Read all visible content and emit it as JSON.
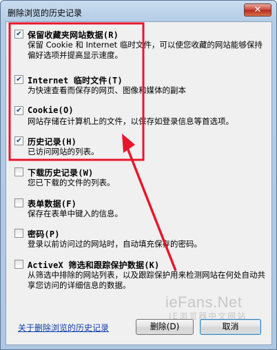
{
  "window": {
    "title": "删除浏览的历史记录",
    "close_label": "✕"
  },
  "options": [
    {
      "checked": true,
      "title": "保留收藏夹网站数据(R)",
      "desc": "保留 Cookie 和 Internet 临时文件，可以使您收藏的网站能够保持偏好选项并提高显示速度。"
    },
    {
      "checked": true,
      "title": "Internet 临时文件(T)",
      "desc": "为快速查看而保存的网页、图像和媒体的副本"
    },
    {
      "checked": true,
      "title": "Cookie(O)",
      "desc": "网站存储在计算机上的文件，以保存如登录信息等首选项。"
    },
    {
      "checked": true,
      "title": "历史记录(H)",
      "desc": "已访问网站的列表。"
    },
    {
      "checked": false,
      "title": "下载历史记录(W)",
      "desc": "您已下载的文件的列表。"
    },
    {
      "checked": false,
      "title": "表单数据(F)",
      "desc": "保存在表单中键入的信息。"
    },
    {
      "checked": false,
      "title": "密码(P)",
      "desc": "登录以前访问过的网站时，自动填充保存的密码。"
    },
    {
      "checked": false,
      "title": "ActiveX 筛选和跟踪保护数据(K)",
      "desc": "从筛选中排除的网站列表，以及跟踪保护用来检测网站在何处自动共享您访问的详细信息的数据。"
    }
  ],
  "footer": {
    "link_label": "关于删除浏览的历史记录",
    "delete_label": "删除(D)",
    "cancel_label": "取消"
  },
  "watermark": {
    "main": "ieFans.Net",
    "sub": "IE浏览器中文网站"
  },
  "colors": {
    "annotation_red": "#e8162b",
    "link_blue": "#0e3fa8"
  }
}
